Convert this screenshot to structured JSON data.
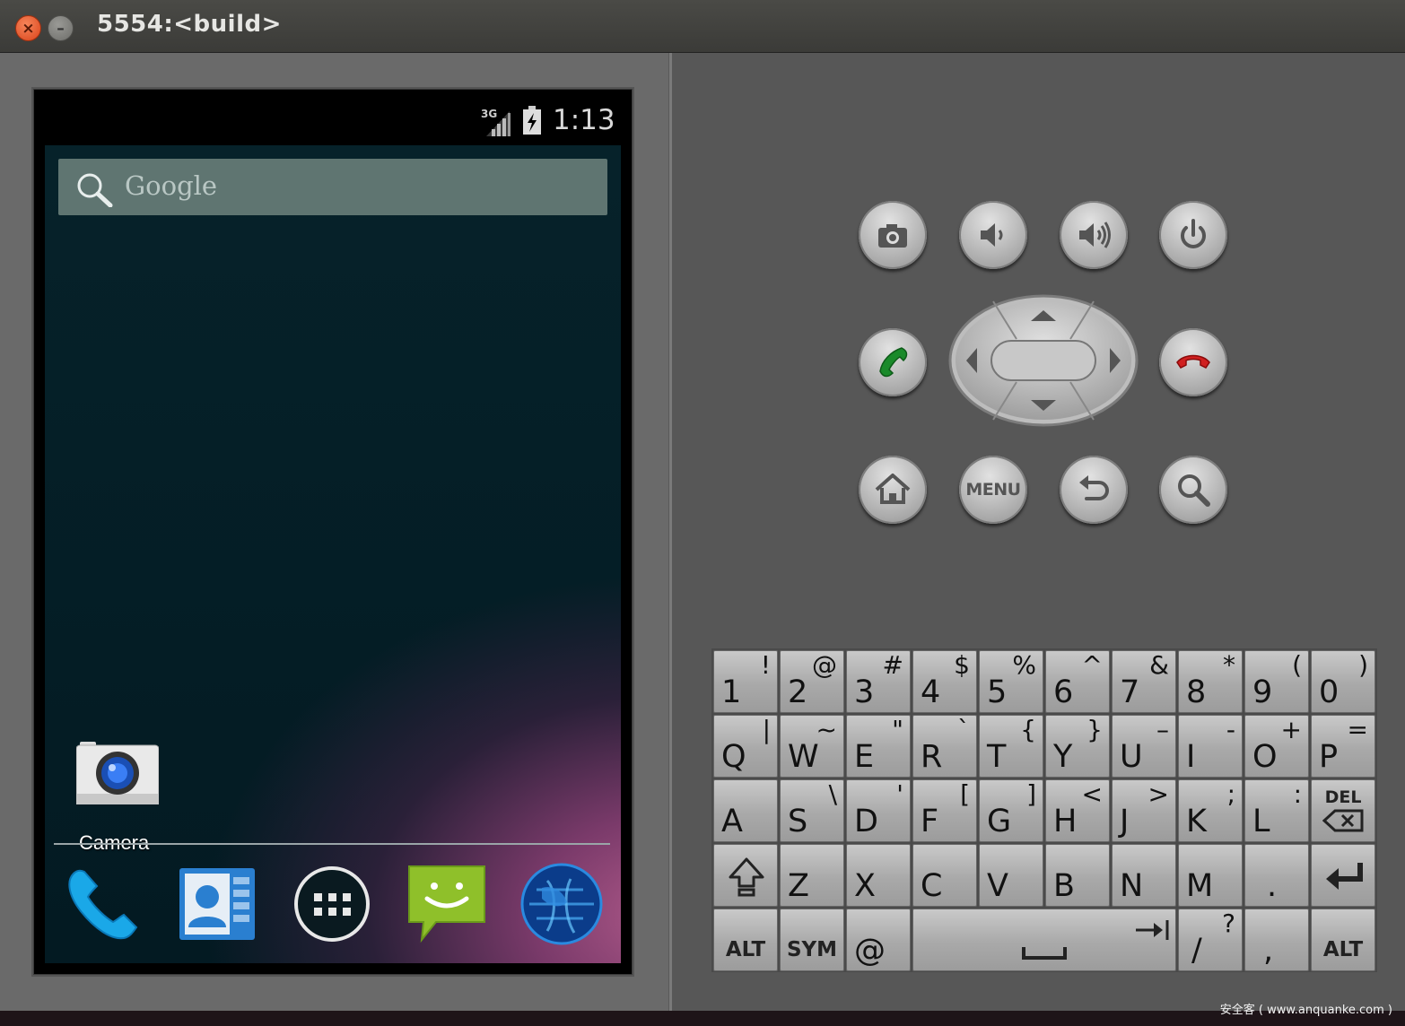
{
  "window": {
    "title": "5554:<build>",
    "close_glyph": "×",
    "minimize_glyph": "–"
  },
  "status_bar": {
    "network": "3G",
    "time": "1:13"
  },
  "home": {
    "search_placeholder": "Google",
    "shortcut_label": "Camera",
    "dock": [
      "phone-icon",
      "contacts-icon",
      "app-drawer-icon",
      "messaging-icon",
      "browser-icon"
    ]
  },
  "hardware_buttons": {
    "menu_label": "MENU",
    "icons": [
      "camera-icon",
      "volume-down-icon",
      "volume-up-icon",
      "power-icon",
      "call-icon",
      "dpad",
      "end-call-icon",
      "home-icon",
      "menu-button",
      "back-icon",
      "search-icon"
    ]
  },
  "keyboard": {
    "row1": [
      [
        "1",
        "!"
      ],
      [
        "2",
        "@"
      ],
      [
        "3",
        "#"
      ],
      [
        "4",
        "$"
      ],
      [
        "5",
        "%"
      ],
      [
        "6",
        "^"
      ],
      [
        "7",
        "&"
      ],
      [
        "8",
        "*"
      ],
      [
        "9",
        "("
      ],
      [
        "0",
        ")"
      ]
    ],
    "row2": [
      [
        "Q",
        "|"
      ],
      [
        "W",
        "~"
      ],
      [
        "E",
        "\""
      ],
      [
        "R",
        "`"
      ],
      [
        "T",
        "{"
      ],
      [
        "Y",
        "}"
      ],
      [
        "U",
        "–"
      ],
      [
        "I",
        "-"
      ],
      [
        "O",
        "+"
      ],
      [
        "P",
        "="
      ]
    ],
    "row3": [
      [
        "A",
        ""
      ],
      [
        "S",
        "\\"
      ],
      [
        "D",
        "'"
      ],
      [
        "F",
        "["
      ],
      [
        "G",
        "]"
      ],
      [
        "H",
        "<"
      ],
      [
        "J",
        ">"
      ],
      [
        "K",
        ";"
      ],
      [
        "L",
        ":"
      ]
    ],
    "row4": [
      [
        "Z",
        ""
      ],
      [
        "X",
        ""
      ],
      [
        "C",
        ""
      ],
      [
        "V",
        ""
      ],
      [
        "B",
        ""
      ],
      [
        "N",
        ""
      ],
      [
        "M",
        ""
      ],
      [
        ".",
        ""
      ]
    ],
    "del_label": "DEL",
    "alt_label": "ALT",
    "sym_label": "SYM",
    "at_label": "@",
    "slash_key": [
      "/",
      "?"
    ],
    "comma_key": [
      ",",
      ""
    ]
  },
  "watermark": "安全客 ( www.anquanke.com )",
  "colors": {
    "accent_call": "#1a8a2a",
    "accent_end": "#d02020",
    "search_bar": "#5f7571"
  }
}
